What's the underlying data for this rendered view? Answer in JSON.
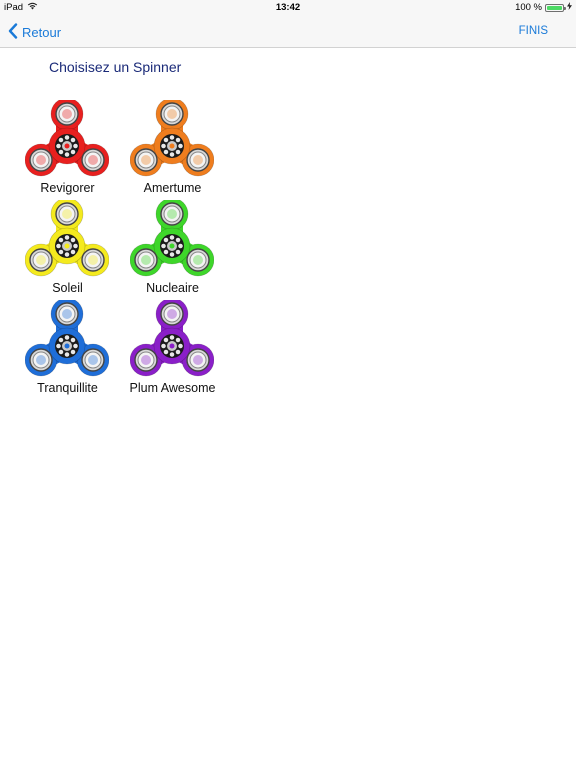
{
  "status_bar": {
    "device": "iPad",
    "time": "13:42",
    "battery": "100 %",
    "battery_level": 1.0
  },
  "nav": {
    "back_label": "Retour",
    "done_label": "FINIS"
  },
  "title": "Choisisez un Spinner",
  "spinners": [
    {
      "name": "Revigorer",
      "color": "#e8201f"
    },
    {
      "name": "Amertume",
      "color": "#ef7d1e"
    },
    {
      "name": "Soleil",
      "color": "#f4ea1e"
    },
    {
      "name": "Nucleaire",
      "color": "#3ed62a"
    },
    {
      "name": "Tranquillite",
      "color": "#1f6ed8"
    },
    {
      "name": "Plum Awesome",
      "color": "#8a1fc8"
    }
  ],
  "colors": {
    "accent": "#1a7ad8",
    "heading": "#1a2a78",
    "bar_background": "#f7f7f7",
    "battery_fill": "#4cd964"
  }
}
